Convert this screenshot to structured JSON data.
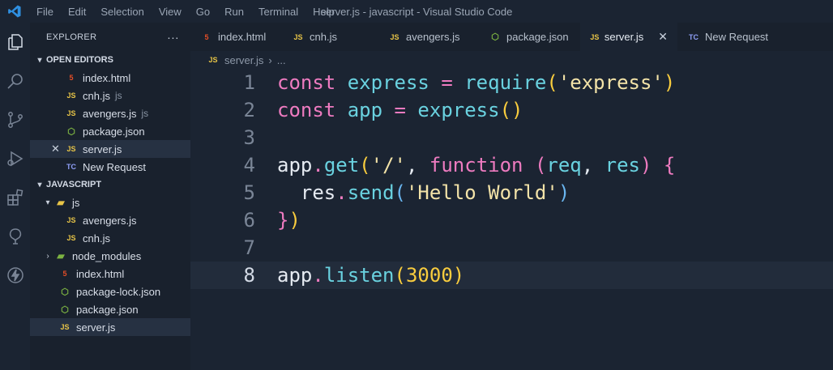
{
  "window": {
    "title": "server.js - javascript - Visual Studio Code",
    "menu": [
      "File",
      "Edit",
      "Selection",
      "View",
      "Go",
      "Run",
      "Terminal",
      "Help"
    ]
  },
  "activity_bar": [
    "explorer-icon",
    "search-icon",
    "source-control-icon",
    "run-debug-icon",
    "extensions-icon",
    "remote-explorer-icon",
    "thunder-client-icon"
  ],
  "explorer": {
    "header": "EXPLORER",
    "more": "···",
    "open_editors": {
      "label": "OPEN EDITORS",
      "items": [
        {
          "icon": "html",
          "name": "index.html",
          "desc": ""
        },
        {
          "icon": "js",
          "name": "cnh.js",
          "desc": "js"
        },
        {
          "icon": "js",
          "name": "avengers.js",
          "desc": "js"
        },
        {
          "icon": "json",
          "name": "package.json",
          "desc": ""
        },
        {
          "icon": "js",
          "name": "server.js",
          "desc": ""
        },
        {
          "icon": "tc",
          "name": "New Request",
          "desc": ""
        }
      ]
    },
    "workspace": {
      "label": "JAVASCRIPT",
      "items": [
        {
          "icon": "folder",
          "name": "js"
        },
        {
          "icon": "js",
          "name": "avengers.js"
        },
        {
          "icon": "js",
          "name": "cnh.js"
        },
        {
          "icon": "folder-node",
          "name": "node_modules"
        },
        {
          "icon": "html",
          "name": "index.html"
        },
        {
          "icon": "json",
          "name": "package-lock.json"
        },
        {
          "icon": "json",
          "name": "package.json"
        },
        {
          "icon": "js",
          "name": "server.js"
        }
      ]
    }
  },
  "tabs": [
    {
      "icon": "html",
      "label": "index.html"
    },
    {
      "icon": "js",
      "label": "cnh.js"
    },
    {
      "icon": "js",
      "label": "avengers.js"
    },
    {
      "icon": "json",
      "label": "package.json"
    },
    {
      "icon": "js",
      "label": "server.js",
      "active": true
    },
    {
      "icon": "tc",
      "label": "New Request"
    }
  ],
  "breadcrumb": {
    "file": "server.js",
    "rest": "..."
  },
  "editor": {
    "line_numbers": [
      "1",
      "2",
      "3",
      "4",
      "5",
      "6",
      "7",
      "8"
    ],
    "current_line": 8,
    "lines": [
      "const express = require('express')",
      "const app = express()",
      "",
      "app.get('/', function (req, res) {",
      "  res.send('Hello World')",
      "})",
      "",
      "app.listen(3000)"
    ]
  },
  "colors": {
    "background": "#1b2432",
    "sidebar": "#19212d",
    "keyword": "#ee7bc0",
    "identifier": "#6ad2e0",
    "string": "#f3e3a8",
    "bracket": "#f8cc3e"
  }
}
